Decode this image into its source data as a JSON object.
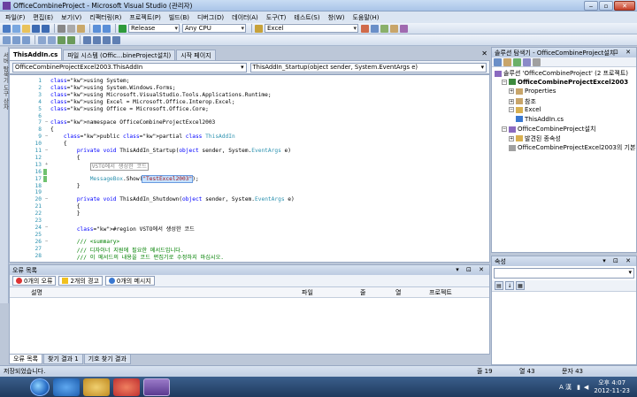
{
  "window": {
    "title": "OfficeCombineProject - Microsoft Visual Studio (관리자)"
  },
  "menu": [
    "파일(F)",
    "편집(E)",
    "보기(V)",
    "리팩터링(R)",
    "프로젝트(P)",
    "빌드(B)",
    "디버그(D)",
    "데이터(A)",
    "도구(T)",
    "테스트(S)",
    "창(W)",
    "도움말(H)"
  ],
  "toolbar": {
    "config": "Release",
    "platform": "Any CPU",
    "find": "Excel"
  },
  "left_strip": {
    "label": "서버 탐색기 도구 상자"
  },
  "doc_tabs": [
    "ThisAddIn.cs",
    "파일 시스템 (Offic...bineProject설치)",
    "시작 페이지"
  ],
  "nav": {
    "class_combo": "OfficeCombineProjectExcel2003.ThisAddIn",
    "member_combo": "ThisAddIn_Startup(object sender, System.EventArgs e)"
  },
  "code_lines": [
    {
      "n": "1",
      "t": "using System;"
    },
    {
      "n": "2",
      "t": "using System.Windows.Forms;"
    },
    {
      "n": "3",
      "t": "using Microsoft.VisualStudio.Tools.Applications.Runtime;"
    },
    {
      "n": "4",
      "t": "using Excel = Microsoft.Office.Interop.Excel;"
    },
    {
      "n": "5",
      "t": "using Office = Microsoft.Office.Core;"
    },
    {
      "n": "6",
      "t": ""
    },
    {
      "n": "7",
      "t": "namespace OfficeCombineProjectExcel2003"
    },
    {
      "n": "8",
      "t": "{"
    },
    {
      "n": "9",
      "t": "    public partial class ThisAddIn"
    },
    {
      "n": "10",
      "t": "    {"
    },
    {
      "n": "11",
      "t": "        private void ThisAddIn_Startup(object sender, System.EventArgs e)"
    },
    {
      "n": "12",
      "t": "        {"
    },
    {
      "n": "13",
      "t": "            VSTO에서 생성한 코드"
    },
    {
      "n": "16",
      "t": ""
    },
    {
      "n": "17",
      "t": "            MessageBox.Show(\"TestExcel2003\");"
    },
    {
      "n": "18",
      "t": "        }"
    },
    {
      "n": "19",
      "t": ""
    },
    {
      "n": "20",
      "t": "        private void ThisAddIn_Shutdown(object sender, System.EventArgs e)"
    },
    {
      "n": "21",
      "t": "        {"
    },
    {
      "n": "22",
      "t": "        }"
    },
    {
      "n": "23",
      "t": ""
    },
    {
      "n": "24",
      "t": "        #region VSTO에서 생성한 코드"
    },
    {
      "n": "25",
      "t": ""
    },
    {
      "n": "26",
      "t": "        /// <summary>"
    },
    {
      "n": "27",
      "t": "        /// 디자이너 지원에 필요한 메서드입니다."
    },
    {
      "n": "28",
      "t": "        /// 이 메서드의 내용을 코드 편집기로 수정하지 마십시오."
    }
  ],
  "error_list": {
    "title": "오류 목록",
    "errors": "0개의 오류",
    "warnings": "2개의 경고",
    "messages": "0개의 메시지",
    "columns": [
      "설명",
      "파일",
      "줄",
      "열",
      "프로젝트"
    ]
  },
  "bottom_tabs": [
    "오류 목록",
    "찾기 결과 1",
    "기호 찾기 결과"
  ],
  "solution": {
    "title": "솔루션 탐색기 - OfficeCombineProject설치",
    "nodes": [
      {
        "label": "솔루션 'OfficeCombineProject' (2 프로젝트)",
        "level": 0,
        "bold": false,
        "exp": ""
      },
      {
        "label": "OfficeCombineProjectExcel2003",
        "level": 1,
        "bold": true,
        "exp": "−"
      },
      {
        "label": "Properties",
        "level": 2,
        "bold": false,
        "exp": "+"
      },
      {
        "label": "참조",
        "level": 2,
        "bold": false,
        "exp": "+"
      },
      {
        "label": "Excel",
        "level": 2,
        "bold": false,
        "exp": "−"
      },
      {
        "label": "ThisAddIn.cs",
        "level": 3,
        "bold": false,
        "exp": ""
      },
      {
        "label": "OfficeCombineProject설치",
        "level": 1,
        "bold": false,
        "exp": "−"
      },
      {
        "label": "발견된 종속성",
        "level": 2,
        "bold": false,
        "exp": "+"
      },
      {
        "label": "OfficeCombineProjectExcel2003의 기본 출",
        "level": 2,
        "bold": false,
        "exp": ""
      }
    ]
  },
  "properties": {
    "title": "속성"
  },
  "status": {
    "left": "저장되었습니다.",
    "ln": "줄 19",
    "col": "열 43",
    "ch": "문자 43"
  },
  "taskbar": {
    "time": "오후 4:07",
    "date": "2012-11-23",
    "ime": "A 漢"
  }
}
